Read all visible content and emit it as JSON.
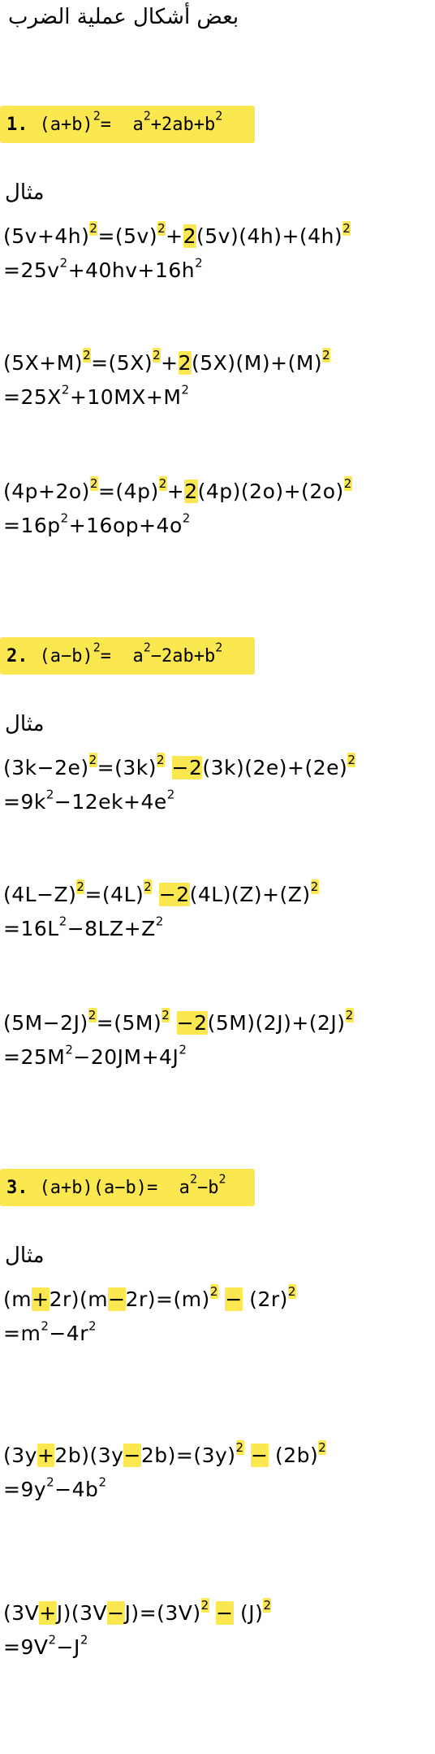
{
  "title": "بعض أشكال عملية الضرب",
  "example_label": "مثال",
  "formulas": [
    {
      "num": "1.",
      "text": "(a+b)²=  a²+2ab+b²"
    },
    {
      "num": "2.",
      "text": "(a−b)²=  a²−2ab+b²"
    },
    {
      "num": "3.",
      "text": "(a+b)(a−b)=  a²−b²"
    }
  ],
  "examples": [
    {
      "l1": "(5v+4h)²=(5v)²+2(5v)(4h)+(4h)²",
      "l2": "=25v²+40hv+16h²"
    },
    {
      "l1": "(5X+M)²=(5X)²+2(5X)(M)+(M)²",
      "l2": "=25X²+10MX+M²"
    },
    {
      "l1": "(4p+2o)²=(4p)²+2(4p)(2o)+(2o)²",
      "l2": "=16p²+16op+4o²"
    },
    {
      "l1": "(3k−2e)²=(3k)² −2(3k)(2e)+(2e)²",
      "l2": "=9k²−12ek+4e²"
    },
    {
      "l1": "(4L−Z)²=(4L)² −2(4L)(Z)+(Z)²",
      "l2": "=16L²−8LZ+Z²"
    },
    {
      "l1": "(5M−2J)²=(5M)² −2(5M)(2J)+(2J)²",
      "l2": "=25M²−20JM+4J²"
    },
    {
      "l1": "(m+2r)(m−2r)=(m)² − (2r)²",
      "l2": "=m²−4r²"
    },
    {
      "l1": "(3y+2b)(3y−2b)=(3y)² − (2b)²",
      "l2": "=9y²−4b²"
    },
    {
      "l1": "(3V+J)(3V−J)=(3V)² − (J)²",
      "l2": "=9V²−J²"
    }
  ],
  "colors": {
    "highlight": "#fbe74f"
  }
}
